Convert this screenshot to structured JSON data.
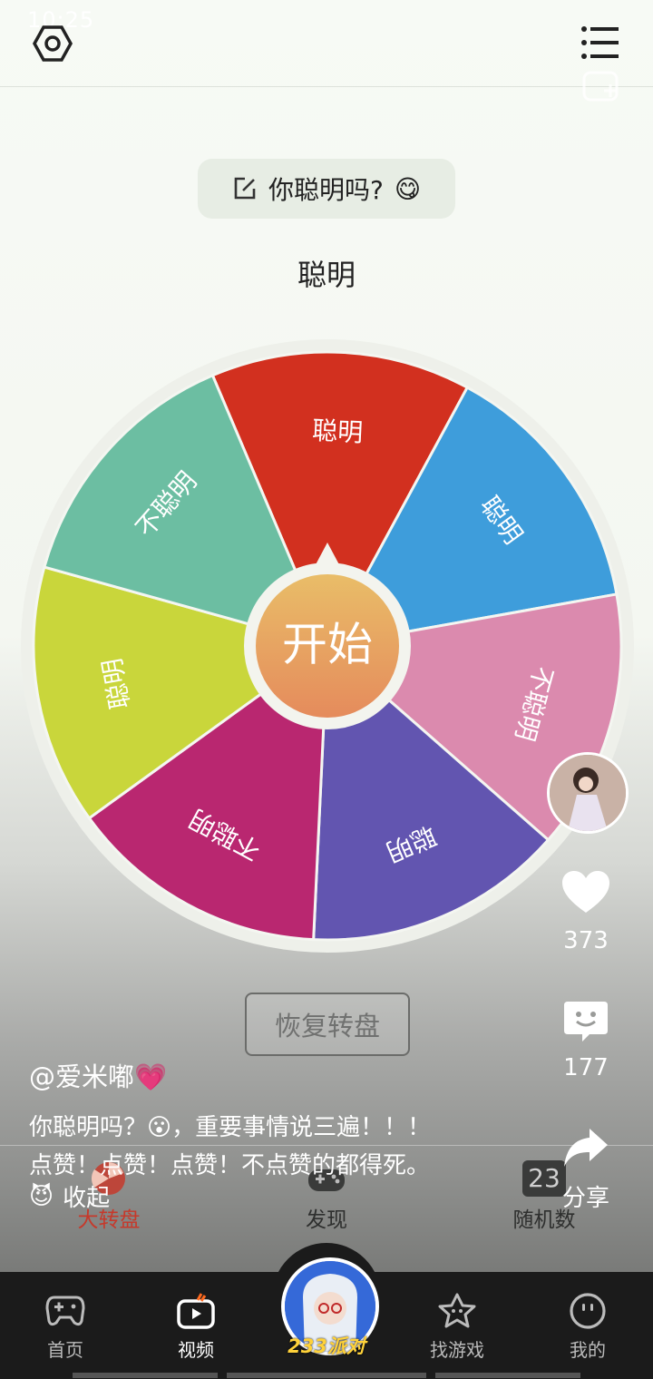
{
  "status_bar": {
    "time": "10:25"
  },
  "header": {
    "settings_icon": "settings-hex-icon",
    "menu_icon": "list-menu-icon",
    "add_icon": "add-square-icon"
  },
  "wheel": {
    "question": "你聪明吗?",
    "question_emoji": "😋",
    "result": "聪明",
    "start_label": "开始",
    "reset_label": "恢复转盘",
    "segments": [
      {
        "label": "聪明",
        "color": "#d2301f"
      },
      {
        "label": "聪明",
        "color": "#3e9ddb"
      },
      {
        "label": "不聪明",
        "color": "#db8aae"
      },
      {
        "label": "聪明",
        "color": "#6255b0"
      },
      {
        "label": "不聪明",
        "color": "#b92770"
      },
      {
        "label": "聪明",
        "color": "#c9d63b"
      },
      {
        "label": "不聪明",
        "color": "#6cbea2"
      }
    ],
    "colors": {
      "hub_orange": "#e69a58",
      "rim": "#eef0ea"
    }
  },
  "app_tabs": [
    {
      "label": "大转盘",
      "icon": "wheel-icon",
      "active": true
    },
    {
      "label": "发现",
      "icon": "gamepad-icon",
      "active": false
    },
    {
      "label": "随机数",
      "icon": "number-23-icon",
      "badge": "23",
      "active": false
    }
  ],
  "video": {
    "author": "@爱米嘟💗",
    "desc_line1": "你聪明吗？😮，重要事情说三遍！！！",
    "desc_line2": "点赞！点赞！点赞！不点赞的都得死。",
    "collapse_emoji": "😈",
    "collapse_label": "收起",
    "likes": "373",
    "comments": "177",
    "share_label": "分享"
  },
  "nav": {
    "items": [
      {
        "label": "首页",
        "icon": "gamepad-nav-icon"
      },
      {
        "label": "视频",
        "icon": "tv-icon"
      },
      {
        "label": "233派对",
        "icon": "party-avatar-icon"
      },
      {
        "label": "找游戏",
        "icon": "star-face-icon"
      },
      {
        "label": "我的",
        "icon": "smile-face-icon"
      }
    ]
  },
  "accent": {
    "red_tab": "#c6392b",
    "gold": "#ffd23a"
  }
}
